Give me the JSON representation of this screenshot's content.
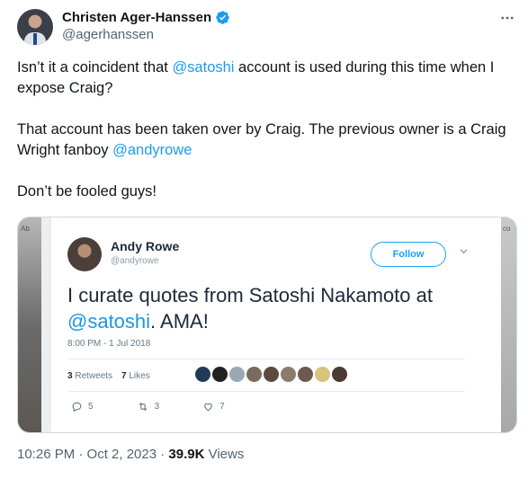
{
  "author": {
    "display_name": "Christen Ager-Hanssen",
    "handle": "@agerhanssen"
  },
  "tweet": {
    "line1_pre": "Isn’t it a coincident that ",
    "line1_mention": "@satoshi",
    "line1_post": " account is used during this time when I expose Craig?",
    "line2_pre": "That account has been taken over by Craig. The previous owner is a Craig Wright fanboy ",
    "line2_mention": "@andyrowe",
    "line3": "Don’t be fooled guys!"
  },
  "embedded": {
    "left_edge_label": "Ab",
    "right_edge_label": "co",
    "name": "Andy Rowe",
    "handle": "@andyrowe",
    "follow_label": "Follow",
    "text_pre": "I curate quotes from Satoshi Nakamoto at ",
    "text_mention": "@satoshi",
    "text_post": ".  AMA!",
    "time": "8:00 PM - 1 Jul 2018",
    "retweets_count": "3",
    "retweets_label": "Retweets",
    "likes_count": "7",
    "likes_label": "Likes",
    "reply_count": "5",
    "retweet_action_count": "3",
    "like_action_count": "7",
    "liker_colors": [
      "#1f3b57",
      "#222222",
      "#9aa7b4",
      "#7a6a5f",
      "#5c4a3e",
      "#8a7b6b",
      "#6b5b4f",
      "#d9c27a",
      "#4b3a30"
    ]
  },
  "footer": {
    "time": "10:26 PM · Oct 2, 2023 · ",
    "views_count": "39.9K",
    "views_label": " Views"
  },
  "colors": {
    "accent": "#1d9bf0",
    "text": "#0f1419",
    "muted": "#536471"
  },
  "icons": [
    "verified-badge-icon",
    "more-options-icon",
    "chevron-down-icon",
    "reply-icon",
    "retweet-icon",
    "like-icon"
  ]
}
